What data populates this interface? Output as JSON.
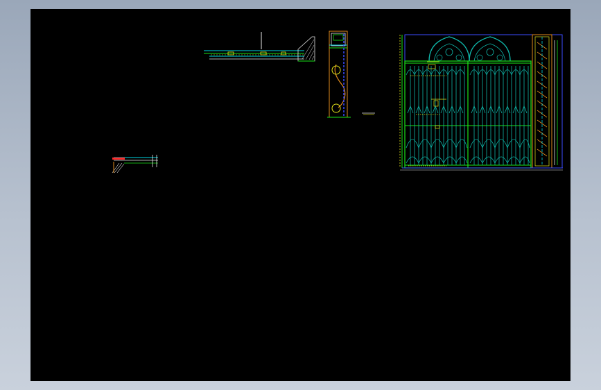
{
  "background_color": "#b7c1cf",
  "viewport": {
    "background": "#000000"
  },
  "palette": {
    "cyan": "#00d9e6",
    "green": "#19e619",
    "blue": "#3b4bff",
    "yellow": "#e6e61a",
    "orange": "#e08a1c",
    "red": "#ff2a2a",
    "white": "#e8e8e8",
    "teal": "#0fb5a8"
  }
}
